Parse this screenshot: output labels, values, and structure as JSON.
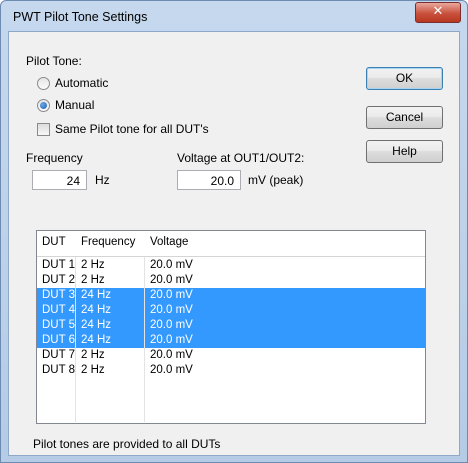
{
  "window": {
    "title": "PWT Pilot Tone Settings",
    "close_glyph": "✕"
  },
  "pilot_tone": {
    "group_label": "Pilot Tone:",
    "automatic_label": "Automatic",
    "manual_label": "Manual",
    "selected": "Manual",
    "same_tone_label": "Same Pilot tone for all DUT's",
    "same_tone_checked": false
  },
  "frequency": {
    "label": "Frequency",
    "value": "24",
    "unit": "Hz"
  },
  "voltage": {
    "label": "Voltage at OUT1/OUT2:",
    "value": "20.0",
    "unit": "mV (peak)"
  },
  "buttons": {
    "ok": "OK",
    "cancel": "Cancel",
    "help": "Help"
  },
  "table": {
    "columns": [
      "DUT",
      "Frequency",
      "Voltage"
    ],
    "rows": [
      {
        "dut": "DUT 1",
        "frequency": "2 Hz",
        "voltage": "20.0 mV",
        "selected": false
      },
      {
        "dut": "DUT 2",
        "frequency": "2 Hz",
        "voltage": "20.0 mV",
        "selected": false
      },
      {
        "dut": "DUT 3",
        "frequency": "24 Hz",
        "voltage": "20.0 mV",
        "selected": true
      },
      {
        "dut": "DUT 4",
        "frequency": "24 Hz",
        "voltage": "20.0 mV",
        "selected": true
      },
      {
        "dut": "DUT 5",
        "frequency": "24 Hz",
        "voltage": "20.0 mV",
        "selected": true
      },
      {
        "dut": "DUT 6",
        "frequency": "24 Hz",
        "voltage": "20.0 mV",
        "selected": true
      },
      {
        "dut": "DUT 7",
        "frequency": "2 Hz",
        "voltage": "20.0 mV",
        "selected": false
      },
      {
        "dut": "DUT 8",
        "frequency": "2 Hz",
        "voltage": "20.0 mV",
        "selected": false
      }
    ]
  },
  "footer": {
    "text": "Pilot tones are provided to all DUTs"
  },
  "colors": {
    "selection": "#3399ff",
    "title_bar": "#c6d8ee",
    "close_button": "#c9513d"
  }
}
